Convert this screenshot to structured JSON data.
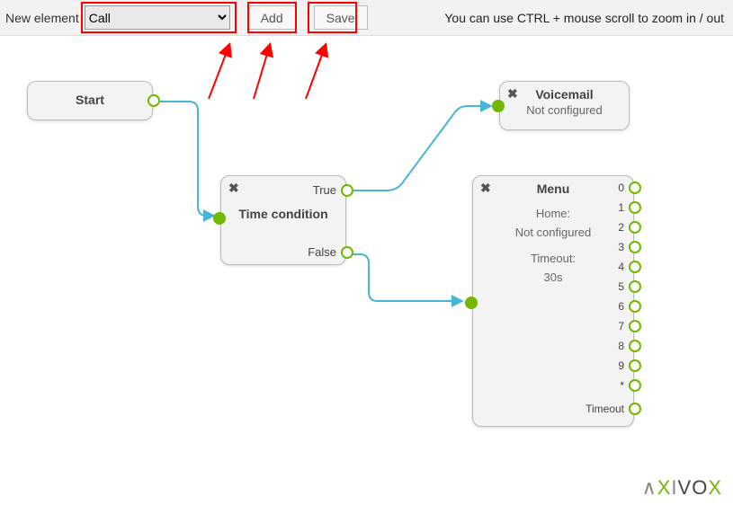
{
  "toolbar": {
    "label": "New element",
    "select_value": "Call",
    "add_label": "Add",
    "save_label": "Save",
    "hint": "You can use CTRL + mouse scroll to zoom in / out"
  },
  "nodes": {
    "start": {
      "title": "Start"
    },
    "time_condition": {
      "title": "Time condition",
      "true_label": "True",
      "false_label": "False"
    },
    "voicemail": {
      "title": "Voicemail",
      "status": "Not configured"
    },
    "menu": {
      "title": "Menu",
      "home_label": "Home:",
      "home_value": "Not configured",
      "timeout_label": "Timeout:",
      "timeout_value": "30s",
      "ports": [
        "0",
        "1",
        "2",
        "3",
        "4",
        "5",
        "6",
        "7",
        "8",
        "9",
        "*",
        "Timeout"
      ]
    }
  },
  "brand": "AXIVOX"
}
